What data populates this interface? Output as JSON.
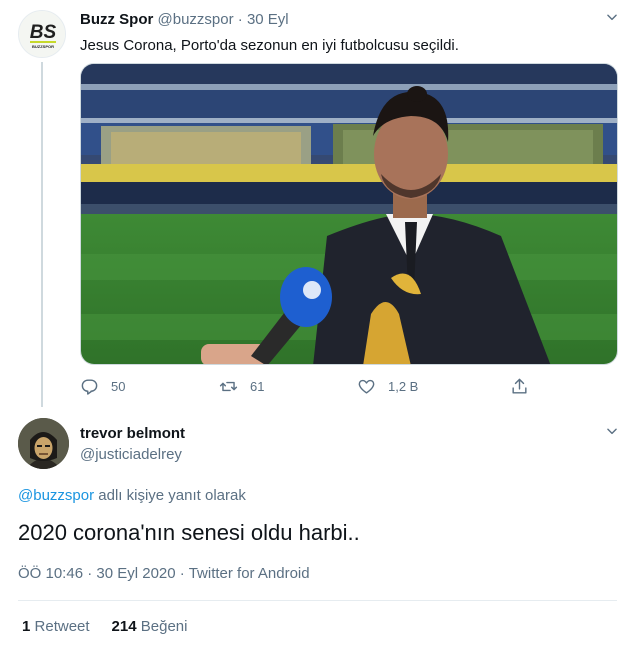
{
  "parent_tweet": {
    "avatar_text": "BS",
    "avatar_subtext": "BUZZSPOR",
    "name": "Buzz Spor",
    "handle": "@buzzspor",
    "separator": "·",
    "date": "30 Eyl",
    "text": "Jesus Corona, Porto'da sezonun en iyi futbolcusu seçildi.",
    "media_icon": "video-thumbnail",
    "replies": "50",
    "retweets": "61",
    "likes": "1,2 B"
  },
  "reply_tweet": {
    "name": "trevor belmont",
    "handle": "@justiciadelrey",
    "replying_to_handle": "@buzzspor",
    "replying_to_suffix": " adlı kişiye yanıt olarak",
    "text": "2020 corona'nın senesi oldu harbi..",
    "time": "ÖÖ 10:46",
    "separator": "·",
    "date": "30 Eyl 2020",
    "separator2": "·",
    "source": "Twitter for Android",
    "retweet_count": "1",
    "retweet_label": "Retweet",
    "like_count": "214",
    "like_label": "Beğeni"
  },
  "colors": {
    "accent": "#1b95e0",
    "secondary_text": "#5b7083",
    "avatar_bs_green": "#c6d92a"
  }
}
